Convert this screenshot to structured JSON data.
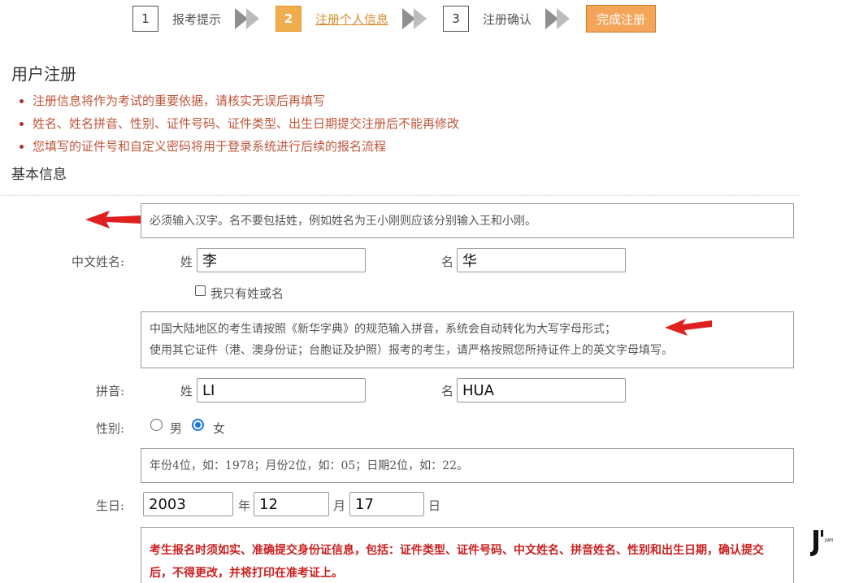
{
  "steps": [
    {
      "num": "1",
      "label": "报考提示"
    },
    {
      "num": "2",
      "label": "注册个人信息"
    },
    {
      "num": "3",
      "label": "注册确认"
    }
  ],
  "finish_label": "完成注册",
  "page_title": "用户注册",
  "notes": [
    "注册信息将作为考试的重要依据，请核实无误后再填写",
    "姓名、姓名拼音、性别、证件号码、证件类型、出生日期提交注册后不能再修改",
    "您填写的证件号和自定义密码将用于登录系统进行后续的报名流程"
  ],
  "section_title": "基本信息",
  "tips": {
    "name": "必须输入汉字。名不要包括姓，例如姓名为王小刚则应该分别输入王和小刚。",
    "pinyin_1": "中国大陆地区的考生请按照《新华字典》的规范输入拼音，系统会自动转化为大写字母形式；",
    "pinyin_2": "使用其它证件（港、澳身份证；台胞证及护照）报考的考生，请严格按照您所持证件上的英文字母填写。",
    "birthday": "年份4位，如：1978；月份2位，如：05；日期2位，如：22。",
    "warning_1": "考生报名时须如实、准确提交身份证信息，包括：证件类型、证件号码、中文姓名、拼音姓名、性别和出生日期，确认提交后，不得更改，并将打印在准考证上。"
  },
  "form": {
    "chinese_name_label": "中文姓名:",
    "surname_label": "姓",
    "given_label": "名",
    "surname_value": "李",
    "given_value": "华",
    "only_surname_label": "我只有姓或名",
    "pinyin_label": "拼音:",
    "pinyin_surname": "LI",
    "pinyin_given": "HUA",
    "gender_label": "性别:",
    "male_label": "男",
    "female_label": "女",
    "gender_selected": "女",
    "birthday_label": "生日:",
    "year_value": "2003",
    "year_unit": "年",
    "month_value": "12",
    "month_unit": "月",
    "day_value": "17",
    "day_unit": "日"
  },
  "logo_text": "JIAYI",
  "colors": {
    "accent": "#f0ad4e",
    "note_red": "#c0553a",
    "warning_red": "#cc1f1f",
    "arrow_red": "#e02020",
    "radio_blue": "#1a73e8"
  }
}
